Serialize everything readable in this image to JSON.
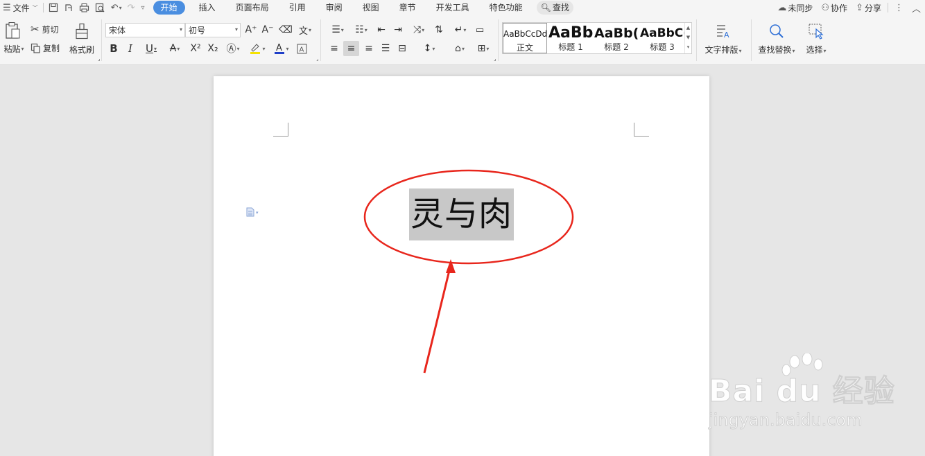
{
  "menu": {
    "file_label": "文件",
    "tabs": [
      "开始",
      "插入",
      "页面布局",
      "引用",
      "审阅",
      "视图",
      "章节",
      "开发工具",
      "特色功能"
    ],
    "search_label": "查找",
    "sync_label": "未同步",
    "collab_label": "协作",
    "share_label": "分享"
  },
  "ribbon": {
    "paste_label": "粘贴",
    "cut_label": "剪切",
    "copy_label": "复制",
    "format_painter_label": "格式刷",
    "font_name": "宋体",
    "font_size": "初号",
    "styles": [
      {
        "sample": "AaBbCcDd",
        "name": "正文"
      },
      {
        "sample": "AaBb",
        "name": "标题 1"
      },
      {
        "sample": "AaBb(",
        "name": "标题 2"
      },
      {
        "sample": "AaBbC(",
        "name": "标题 3"
      }
    ],
    "text_layout_label": "文字排版",
    "find_replace_label": "查找替换",
    "select_label": "选择"
  },
  "document": {
    "selected_text": "灵与肉"
  },
  "watermark": {
    "brand": "Bai du 经验",
    "url": "jingyan.baidu.com"
  },
  "colors": {
    "accent": "#4a8ee0",
    "annotation": "#e8261c",
    "highlight_gray": "#c8c8c8"
  }
}
